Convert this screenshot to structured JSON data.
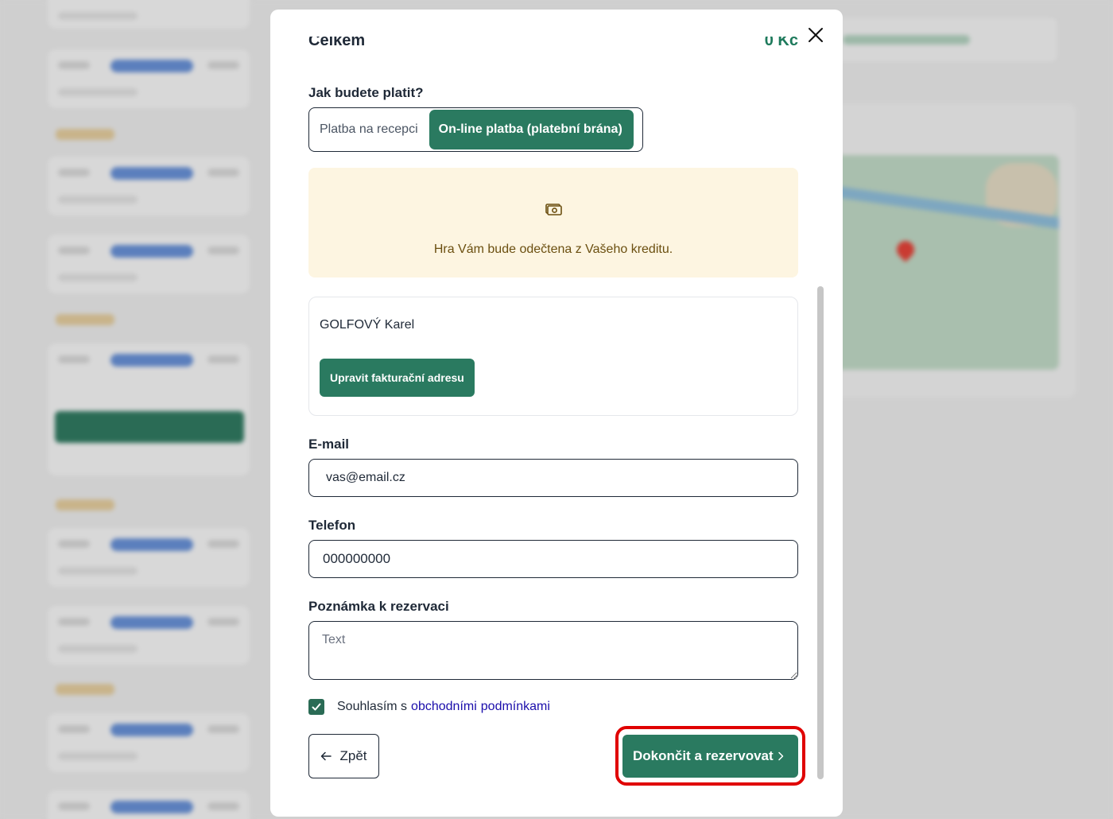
{
  "summary": {
    "total_label": "Celkem",
    "total_value": "0 Kč"
  },
  "payment": {
    "question": "Jak budete platit?",
    "options": [
      {
        "label": "Platba na recepci",
        "selected": false
      },
      {
        "label": "On-line platba (platební brána)",
        "selected": true
      }
    ],
    "info_icon": "cash-icon",
    "info_message": "Hra Vám bude odečtena z Vašeho kreditu."
  },
  "billing": {
    "name": "GOLFOVÝ Karel",
    "edit_button": "Upravit fakturační adresu"
  },
  "form": {
    "email_label": "E-mail",
    "email_value": "vas@email.cz",
    "phone_label": "Telefon",
    "phone_value": "000000000",
    "note_label": "Poznámka k rezervaci",
    "note_placeholder": "Text"
  },
  "consent": {
    "checked": true,
    "text": "Souhlasím s",
    "link_word1": "obchodními",
    "link_word2": "podmínkami"
  },
  "actions": {
    "back_label": "Zpět",
    "finish_label": "Dokončit a rezervovat"
  },
  "colors": {
    "brand_green": "#2a7a60",
    "highlight_red": "#e00000",
    "info_bg": "#fdf5e1"
  }
}
